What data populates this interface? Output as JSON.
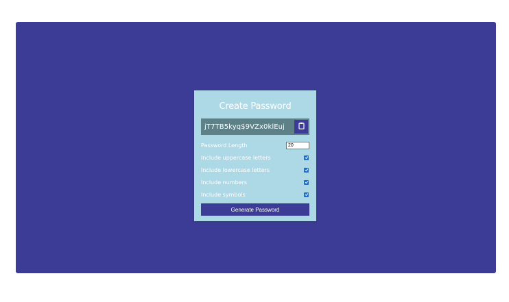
{
  "title": "Create Password",
  "result": {
    "password": "jT7TB5kyq$9VZx0klEuj",
    "clipboard_icon": "clipboard-icon"
  },
  "settings": {
    "length_label": "Password Length",
    "length_value": "20",
    "options": [
      {
        "label": "Include uppercase letters",
        "checked": true
      },
      {
        "label": "Include lowercase letters",
        "checked": true
      },
      {
        "label": "Include numbers",
        "checked": true
      },
      {
        "label": "Include symbols",
        "checked": true
      }
    ]
  },
  "generate_label": "Generate Password",
  "colors": {
    "background": "#3c3c96",
    "card": "#add8e6",
    "result_box": "#5e8187",
    "checkbox": "#1a6ed8"
  }
}
